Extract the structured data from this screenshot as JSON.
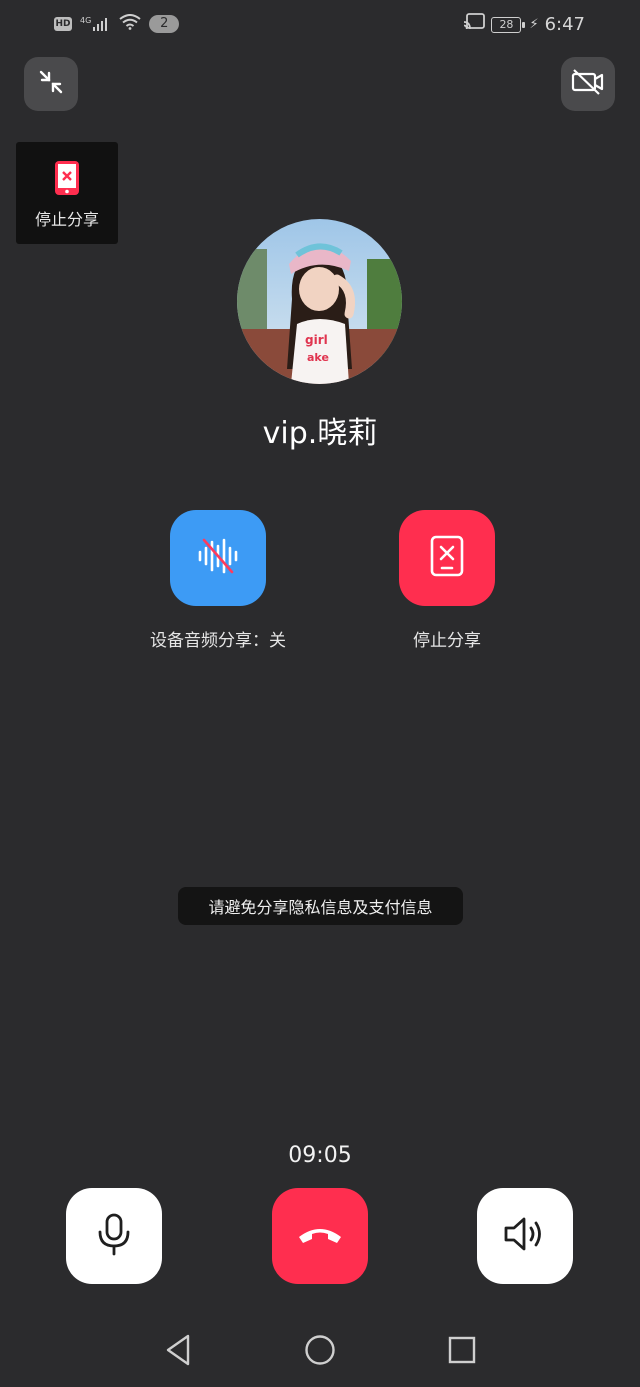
{
  "status_bar": {
    "hd_label": "HD",
    "network_label": "4G",
    "notification_count": "2",
    "battery_level": "28",
    "time": "6:47",
    "icons": [
      "hd-icon",
      "signal-icon",
      "wifi-icon",
      "cast-icon",
      "battery-icon",
      "charging-icon"
    ]
  },
  "top_controls": {
    "minimize_icon": "minimize-icon",
    "camera_off_icon": "camera-off-icon"
  },
  "share_card": {
    "label": "停止分享",
    "icon": "phone-stop-share-icon"
  },
  "contact": {
    "name": "vip.晓莉",
    "avatar": "avatar-photo"
  },
  "actions": {
    "audio_share_label": "设备音频分享：关",
    "stop_share_label": "停止分享"
  },
  "notice": "请避免分享隐私信息及支付信息",
  "call": {
    "duration": "09:05"
  },
  "colors": {
    "background": "#2b2b2d",
    "audio_share_button": "#3d9bf5",
    "stop_share_button": "#ff2e4f",
    "hangup_button": "#ff2e4f",
    "control_button": "#ffffff"
  },
  "nav_bar": {
    "icons": [
      "back-icon",
      "home-icon",
      "recents-icon"
    ]
  }
}
